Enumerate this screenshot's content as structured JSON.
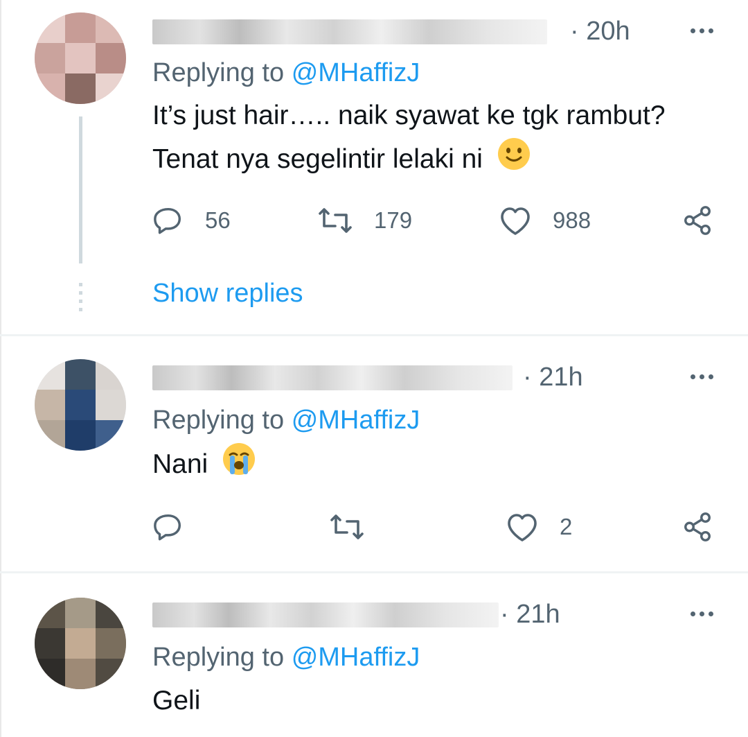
{
  "replies": [
    {
      "time": "· 20h",
      "replying_prefix": "Replying to",
      "replying_handle": "@MHaffizJ",
      "text_lines": [
        "It’s just hair….. naik syawat ke tgk rambut?",
        "Tenat nya segelintir lelaki ni"
      ],
      "emoji": "slightly-smiling-face",
      "counts": {
        "reply": "56",
        "retweet": "179",
        "like": "988"
      },
      "show_replies": "Show replies"
    },
    {
      "time": "· 21h",
      "replying_prefix": "Replying to",
      "replying_handle": "@MHaffizJ",
      "text_lines": [
        "Nani"
      ],
      "emoji": "loudly-crying-face",
      "counts": {
        "reply": "",
        "retweet": "",
        "like": "2"
      }
    },
    {
      "time": "· 21h",
      "replying_prefix": "Replying to",
      "replying_handle": "@MHaffizJ",
      "text_lines": [
        "Geli"
      ]
    }
  ],
  "colors": {
    "accent": "#1d9bf0",
    "secondary_text": "#536471",
    "primary_text": "#0f1419",
    "divider": "#eff3f4",
    "emoji_yellow": "#ffcc4d"
  },
  "icons": [
    "more-icon",
    "reply-icon",
    "retweet-icon",
    "like-icon",
    "share-icon"
  ]
}
